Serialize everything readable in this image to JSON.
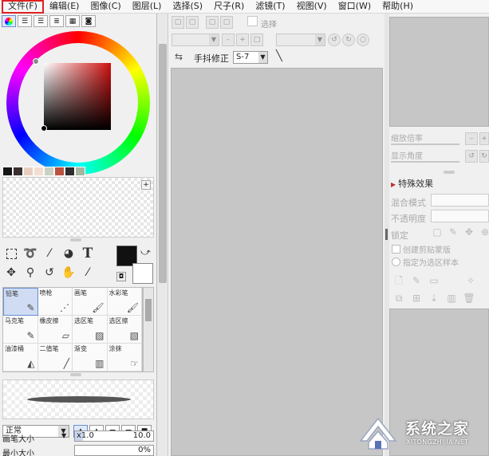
{
  "menu": {
    "items": [
      "文件(F)",
      "编辑(E)",
      "图像(C)",
      "图层(L)",
      "选择(S)",
      "尺子(R)",
      "滤镜(T)",
      "视图(V)",
      "窗口(W)",
      "帮助(H)"
    ]
  },
  "color_panel": {
    "swatches": [
      "#151515",
      "#3a2f2f",
      "#e7cfc0",
      "#f2ded2",
      "#c9d2c0",
      "#b9513f",
      "#2d2d2d",
      "#a7b59f"
    ]
  },
  "tools": {
    "brushes": [
      {
        "label": "铅笔",
        "icon": "pencil-icon"
      },
      {
        "label": "喷枪",
        "icon": "airbrush-icon"
      },
      {
        "label": "画笔",
        "icon": "brush-icon"
      },
      {
        "label": "水彩笔",
        "icon": "watercolor-icon"
      },
      {
        "label": "马克笔",
        "icon": "marker-icon"
      },
      {
        "label": "橡皮擦",
        "icon": "eraser-icon"
      },
      {
        "label": "选区笔",
        "icon": "select-pen-icon"
      },
      {
        "label": "选区擦",
        "icon": "select-eraser-icon"
      },
      {
        "label": "油漆桶",
        "icon": "bucket-icon"
      },
      {
        "label": "二值笔",
        "icon": "binary-pen-icon"
      },
      {
        "label": "渐变",
        "icon": "gradient-icon"
      },
      {
        "label": "涂抹",
        "icon": "smudge-icon"
      }
    ],
    "blend_mode": "正常",
    "brush_size_label": "画笔大小",
    "brush_size_multiplier": "x1.0",
    "brush_size_value": "10.0",
    "min_size_label": "最小大小",
    "min_size_value": "0%"
  },
  "canvas_toolbar": {
    "select_label": "选择",
    "stabilizer_label": "手抖修正",
    "stabilizer_value": "S-7"
  },
  "navigator": {
    "zoom_label": "缩放倍率",
    "rotate_label": "显示角度"
  },
  "layer_panel": {
    "effects_label": "特殊效果",
    "blend_label": "混合模式",
    "opacity_label": "不透明度",
    "lock_label": "锁定",
    "clipping_label": "创建剪贴蒙版",
    "selection_source_label": "指定为选区样本"
  },
  "watermark": {
    "title": "系统之家",
    "url": "XITONGZHIJIA.NET"
  }
}
